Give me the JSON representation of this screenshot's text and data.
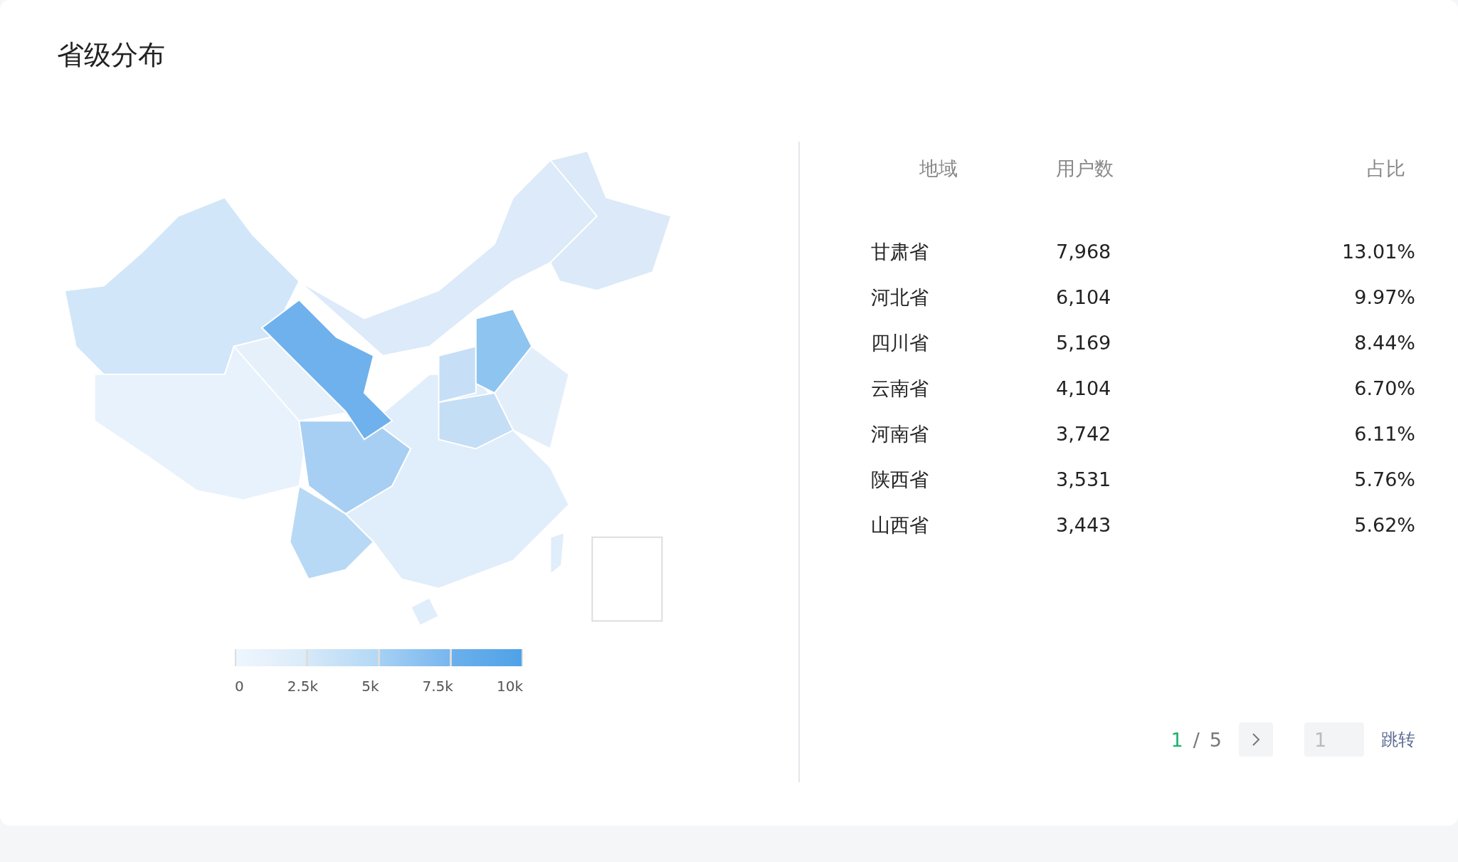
{
  "title": "省级分布",
  "legend": {
    "labels": [
      "0",
      "2.5k",
      "5k",
      "7.5k",
      "10k"
    ]
  },
  "table": {
    "columns": [
      "地域",
      "用户数",
      "占比"
    ],
    "rows": [
      {
        "region": "甘肃省",
        "users": "7,968",
        "share": "13.01%"
      },
      {
        "region": "河北省",
        "users": "6,104",
        "share": "9.97%"
      },
      {
        "region": "四川省",
        "users": "5,169",
        "share": "8.44%"
      },
      {
        "region": "云南省",
        "users": "4,104",
        "share": "6.70%"
      },
      {
        "region": "河南省",
        "users": "3,742",
        "share": "6.11%"
      },
      {
        "region": "陕西省",
        "users": "3,531",
        "share": "5.76%"
      },
      {
        "region": "山西省",
        "users": "3,443",
        "share": "5.62%"
      }
    ]
  },
  "pagination": {
    "current": "1",
    "separator": "/",
    "total": "5",
    "jump_placeholder": "1",
    "jump_label": "跳转"
  }
}
